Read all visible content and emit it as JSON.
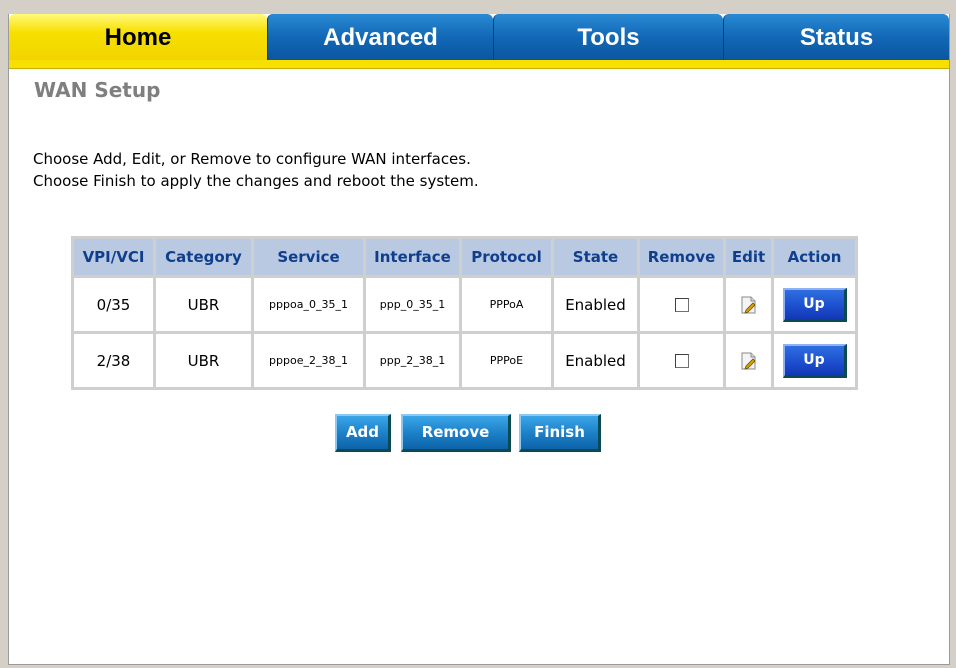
{
  "tabs": [
    {
      "label": "Home"
    },
    {
      "label": "Advanced"
    },
    {
      "label": "Tools"
    },
    {
      "label": "Status"
    }
  ],
  "page": {
    "title": "WAN Setup",
    "description_line1": "Choose Add, Edit, or Remove to configure WAN interfaces.",
    "description_line2": "Choose Finish to apply the changes and reboot the system."
  },
  "table": {
    "headers": [
      "VPI/VCI",
      "Category",
      "Service",
      "Interface",
      "Protocol",
      "State",
      "Remove",
      "Edit",
      "Action"
    ],
    "rows": [
      {
        "vpi_vci": "0/35",
        "category": "UBR",
        "service": "pppoa_0_35_1",
        "interface": "ppp_0_35_1",
        "protocol": "PPPoA",
        "state": "Enabled",
        "action": "Up"
      },
      {
        "vpi_vci": "2/38",
        "category": "UBR",
        "service": "pppoe_2_38_1",
        "interface": "ppp_2_38_1",
        "protocol": "PPPoE",
        "state": "Enabled",
        "action": "Up"
      }
    ]
  },
  "buttons": {
    "add": "Add",
    "remove": "Remove",
    "finish": "Finish"
  },
  "colors": {
    "active_tab": "#f7e000",
    "inactive_tab": "#1268b6",
    "header_bg": "#b9c9e2",
    "header_text": "#0f3f8c",
    "button": "#1c7ec6"
  }
}
